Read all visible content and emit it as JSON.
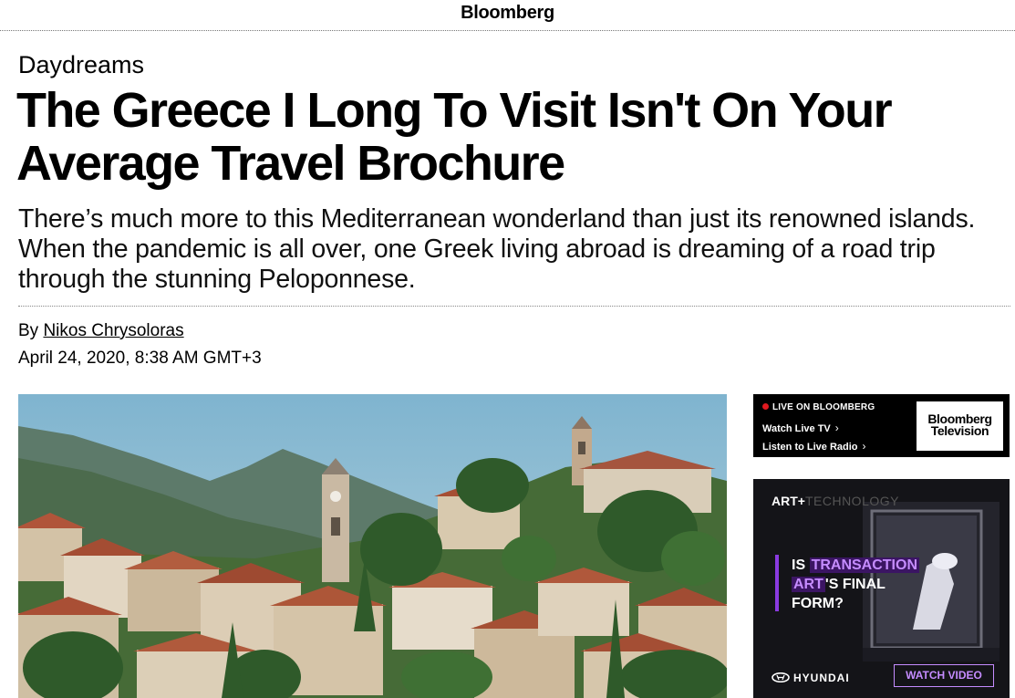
{
  "header": {
    "logo": "Bloomberg"
  },
  "article": {
    "kicker": "Daydreams",
    "headline": "The Greece I Long To Visit Isn't On Your Average Travel Brochure",
    "dek": "There’s much more to this Mediterranean wonderland than just its renowned islands. When the pandemic is all over, one Greek living abroad is dreaming of a road trip through the stunning Peloponnese.",
    "byline_prefix": "By ",
    "author": "Nikos Chrysoloras",
    "date": "April 24, 2020, 8:38 AM GMT+3"
  },
  "live": {
    "label": "LIVE ON BLOOMBERG",
    "watch": "Watch Live TV",
    "listen": "Listen to Live Radio",
    "logo_line1": "Bloomberg",
    "logo_line2": "Television",
    "chevron": "›"
  },
  "ad": {
    "tag_a": "ART+",
    "tag_b": "TECHNOLOGY",
    "line1_a": "IS ",
    "line1_b": "TRANSACTION",
    "line2_a": "ART",
    "line2_b": "'S FINAL",
    "line3": "FORM?",
    "brand": "HYUNDAI",
    "cta": "WATCH VIDEO"
  },
  "colors": {
    "live_dot": "#e0191f",
    "ad_accent": "#c58cff",
    "ad_bg": "#141418"
  }
}
